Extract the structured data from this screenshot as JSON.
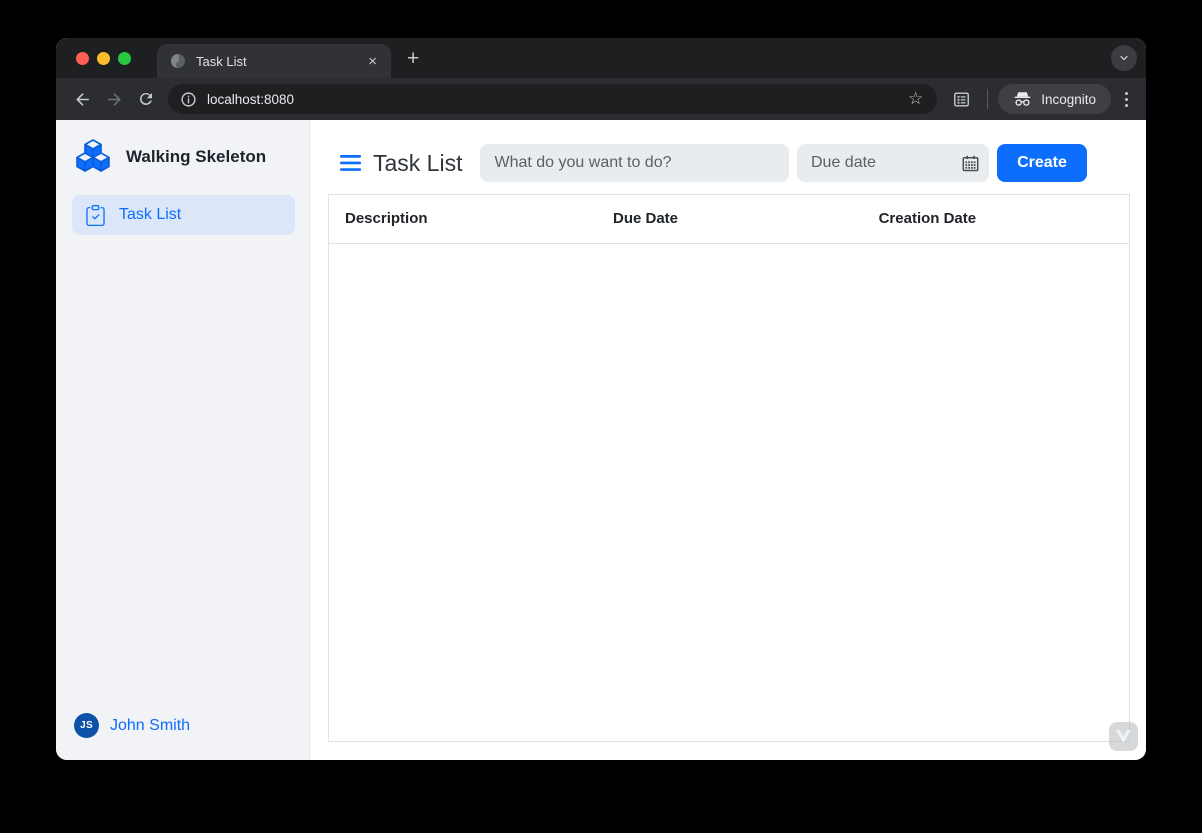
{
  "browser": {
    "tab_title": "Task List",
    "close_tab_glyph": "×",
    "new_tab_glyph": "+",
    "url": "localhost:8080",
    "incognito_label": "Incognito"
  },
  "sidebar": {
    "brand_name": "Walking Skeleton",
    "nav_items": [
      {
        "label": "Task List",
        "active": true
      }
    ],
    "user": {
      "initials": "JS",
      "name": "John Smith"
    }
  },
  "main": {
    "heading": "Task List",
    "task_input": {
      "placeholder": "What do you want to do?",
      "value": ""
    },
    "due_date_input": {
      "placeholder": "Due date",
      "value": ""
    },
    "create_button_label": "Create",
    "table": {
      "columns": [
        "Description",
        "Due Date",
        "Creation Date"
      ],
      "rows": []
    }
  },
  "colors": {
    "accent_blue": "#0d6efd",
    "nav_active_bg": "#dbe6f8",
    "sidebar_bg": "#f1f3f6",
    "avatar_blue": "#0d52a8",
    "tabstrip_bg": "#1e1f21",
    "toolbar_bg": "#2b2d30",
    "traffic_red": "#ff5f57",
    "traffic_yellow": "#febc2e",
    "traffic_green": "#28c840"
  }
}
